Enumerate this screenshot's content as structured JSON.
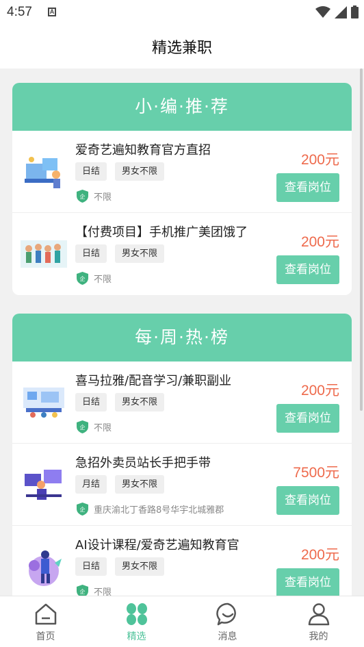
{
  "status": {
    "time": "4:57"
  },
  "header": {
    "title": "精选兼职"
  },
  "sections": [
    {
      "title": "小·编·推·荐",
      "jobs": [
        {
          "title": "爱奇艺遍知教育官方直招",
          "tags": [
            "日结",
            "男女不限"
          ],
          "location": "不限",
          "price": "200元",
          "button": "查看岗位"
        },
        {
          "title": "【付费项目】手机推广美团饿了",
          "tags": [
            "日结",
            "男女不限"
          ],
          "location": "不限",
          "price": "200元",
          "button": "查看岗位"
        }
      ]
    },
    {
      "title": "每·周·热·榜",
      "jobs": [
        {
          "title": "喜马拉雅/配音学习/兼职副业",
          "tags": [
            "日结",
            "男女不限"
          ],
          "location": "不限",
          "price": "200元",
          "button": "查看岗位"
        },
        {
          "title": "急招外卖员站长手把手带",
          "tags": [
            "月结",
            "男女不限"
          ],
          "location": "重庆渝北丁香路8号华宇北城雅郡",
          "price": "7500元",
          "button": "查看岗位"
        },
        {
          "title": "AI设计课程/爱奇艺遍知教育官",
          "tags": [
            "日结",
            "男女不限"
          ],
          "location": "不限",
          "price": "200元",
          "button": "查看岗位"
        }
      ]
    }
  ],
  "tabs": [
    {
      "label": "首页",
      "icon": "home-icon"
    },
    {
      "label": "精选",
      "icon": "grid-icon"
    },
    {
      "label": "消息",
      "icon": "message-icon"
    },
    {
      "label": "我的",
      "icon": "user-icon"
    }
  ],
  "colors": {
    "accent": "#67cfab",
    "price": "#ee6a4c",
    "active_tab": "#4fc39a"
  }
}
